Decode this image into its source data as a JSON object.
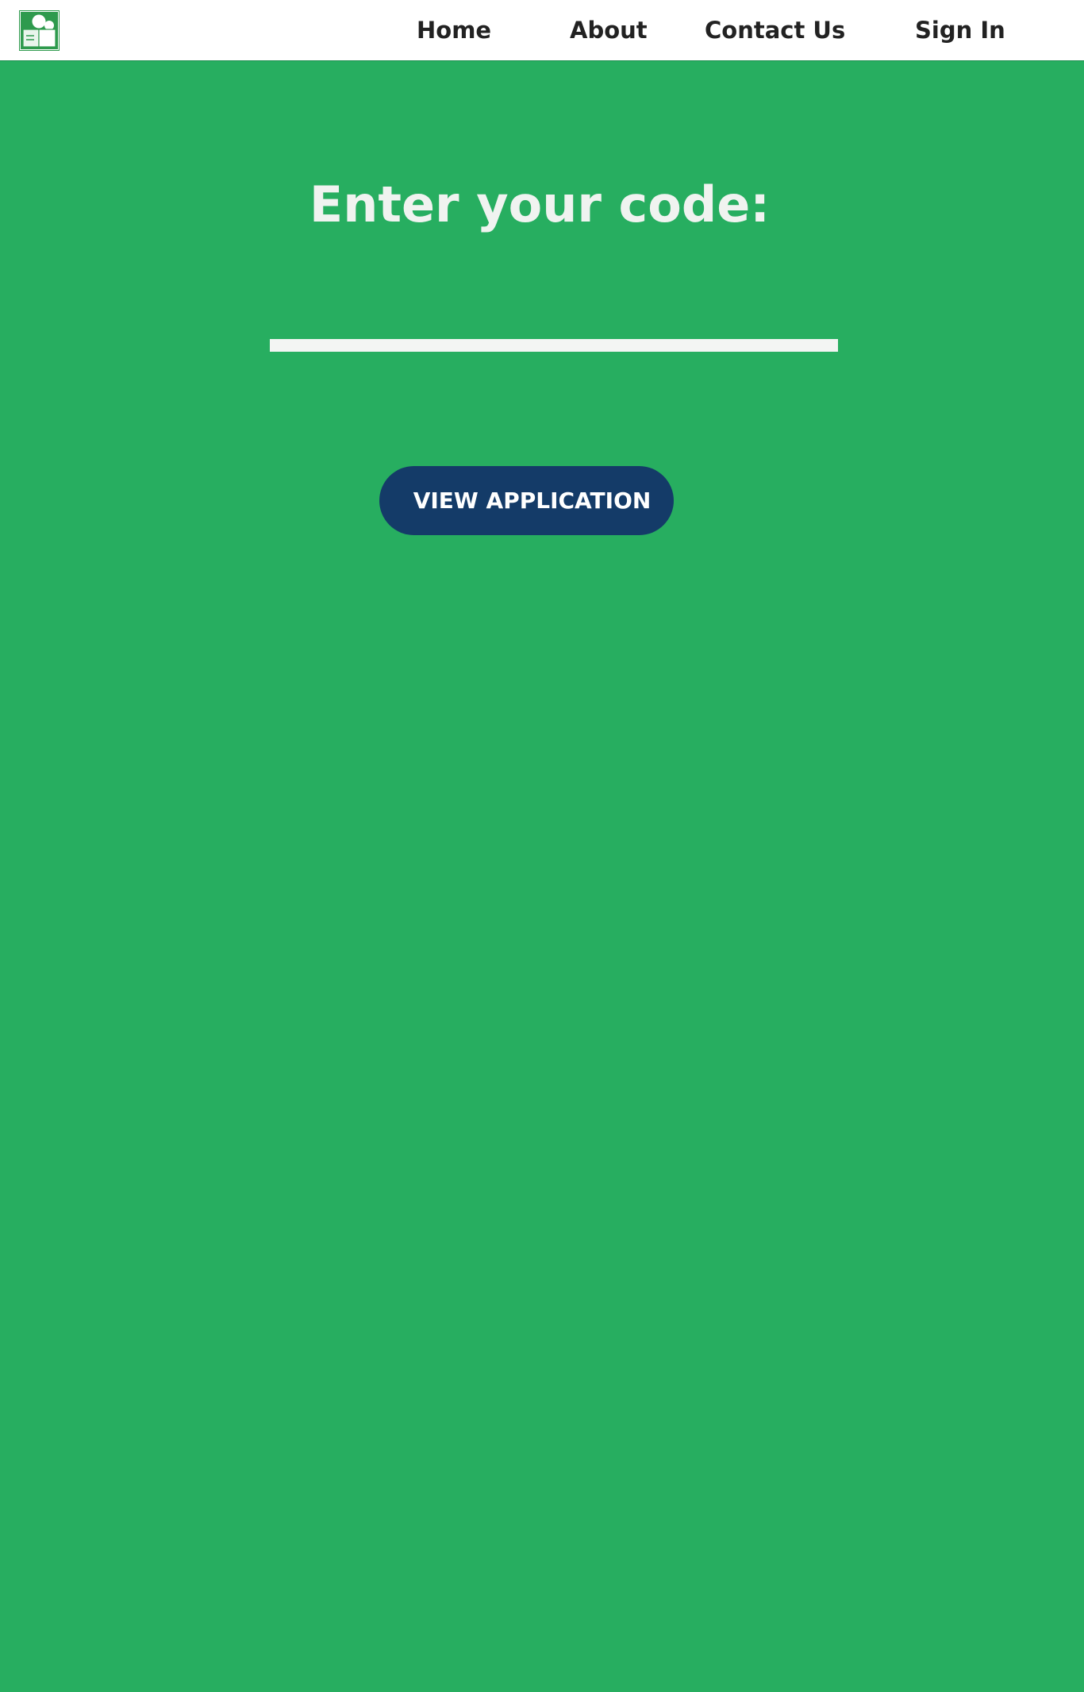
{
  "header": {
    "logo_icon": "family-dictionary-logo-icon",
    "nav": {
      "home": "Home",
      "about": "About",
      "contact": "Contact Us",
      "signin": "Sign In"
    }
  },
  "main": {
    "heading": "Enter your code:",
    "code_input": {
      "value": "",
      "placeholder": ""
    },
    "view_button_label": "VIEW APPLICATION"
  },
  "colors": {
    "page_background": "#27ae60",
    "header_background": "#ffffff",
    "nav_text": "#222222",
    "heading_text": "#f0f3f0",
    "button_background": "#143b68",
    "button_text": "#ffffff",
    "logo_green": "#2e9a4d"
  }
}
